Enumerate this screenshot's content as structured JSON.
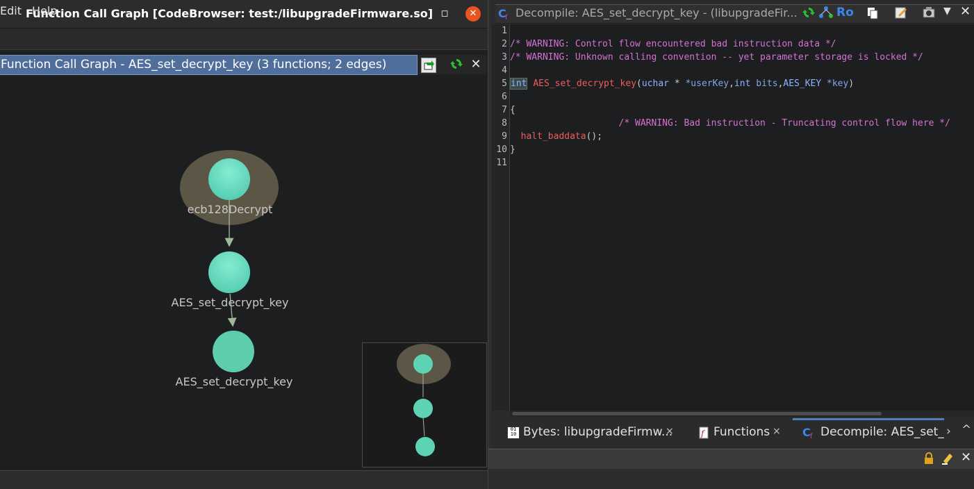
{
  "window": {
    "title": "Function Call Graph [CodeBrowser: test:/libupgradeFirmware.so]",
    "minimize_glyph": "–",
    "maximize_glyph": "◻",
    "close_glyph": "✕"
  },
  "menu": [
    "Edit",
    "Help"
  ],
  "graph_panel": {
    "title": "Function Call Graph - AES_set_decrypt_key (3 functions; 2 edges)",
    "nodes": [
      {
        "label": "ecb128Decrypt",
        "highlighted": true
      },
      {
        "label": "AES_set_decrypt_key",
        "highlighted": false
      },
      {
        "label": "AES_set_decrypt_key",
        "highlighted": false
      }
    ],
    "edges": [
      {
        "from": "ecb128Decrypt",
        "to": "AES_set_decrypt_key"
      },
      {
        "from": "AES_set_decrypt_key",
        "to": "AES_set_decrypt_key"
      }
    ],
    "icons": [
      "export-graph-icon",
      "refresh-icon",
      "close-icon"
    ]
  },
  "decompiler": {
    "title": "Decompile: AES_set_decrypt_key -  (libupgradeFir...",
    "ro_label": "Ro",
    "line_numbers": [
      "1",
      "2",
      "3",
      "4",
      "5",
      "6",
      "7",
      "8",
      "9",
      "10",
      "11"
    ],
    "lines": {
      "l2": "/* WARNING: Control flow encountered bad instruction data */",
      "l3": "/* WARNING: Unknown calling convention -- yet parameter storage is locked */",
      "l5_type": "int",
      "l5_name": "AES_set_decrypt_key",
      "l5_open": "(",
      "l5_t1": "uchar",
      "l5_p1": " *userKey",
      "l5_comma1": ",",
      "l5_t2": "int",
      "l5_p2": " bits",
      "l5_comma2": ",",
      "l5_t3": "AES_KEY",
      "l5_p3": " *key",
      "l5_close": ")",
      "l7": "{",
      "l8": "                    /* WARNING: Bad instruction - Truncating control flow here */",
      "l9_name": "  halt_baddata",
      "l9_rest": "();",
      "l10": "}"
    }
  },
  "tabs": [
    {
      "label": "Bytes: libupgradeFirmw...",
      "close": "×"
    },
    {
      "label": "Functions",
      "close": "×"
    },
    {
      "label": "Decompile: AES_set_d",
      "close": ""
    }
  ],
  "colors": {
    "node_fill": "#5ed3b4",
    "highlight_halo": "#5b5645",
    "edge": "#9fb89a",
    "panel_title_bg": "#506e9c",
    "comment": "#d472d4",
    "keyword": "#8fb4ff",
    "function_name": "#f05c5c"
  }
}
